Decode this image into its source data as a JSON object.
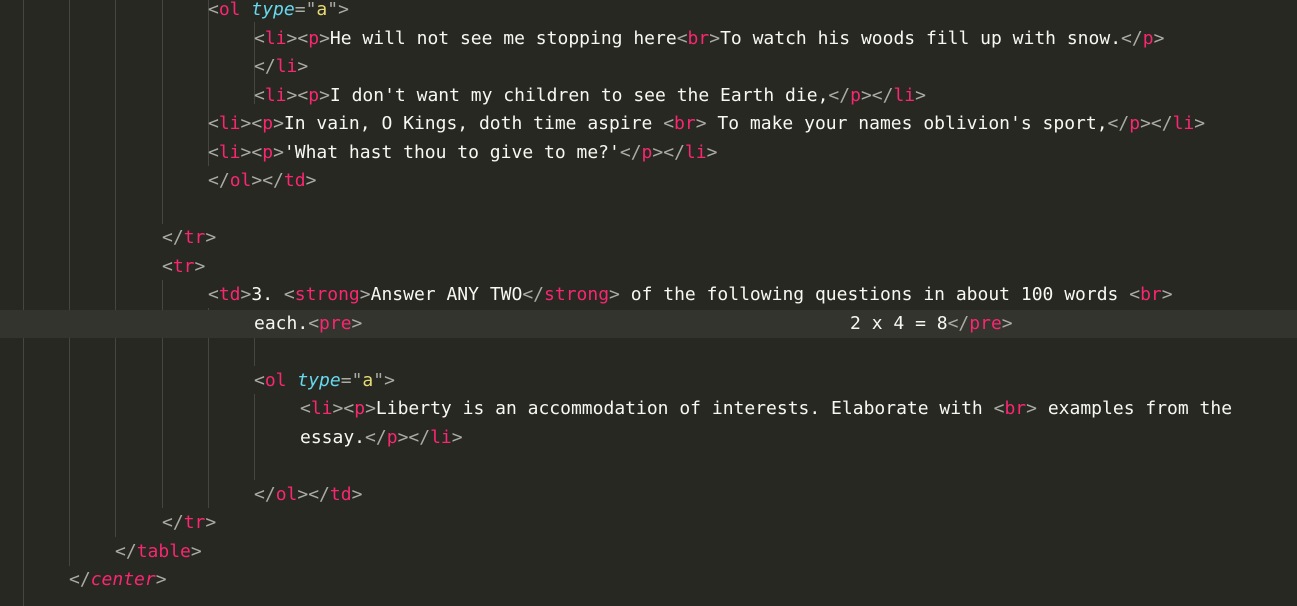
{
  "editor": {
    "colors": {
      "background": "#272822",
      "tag": "#f92672",
      "attribute": "#66d9ef",
      "string": "#e6db74",
      "punctuation": "#a9aba4",
      "text": "#f8f8f2",
      "active_line": "#33342e"
    },
    "active_line_index": 11,
    "lines": [
      [
        [
          "p",
          "<"
        ],
        [
          "t",
          "ol"
        ],
        [
          "x",
          " "
        ],
        [
          "a",
          "type"
        ],
        [
          "p",
          "=\""
        ],
        [
          "q",
          "a"
        ],
        [
          "p",
          "\">"
        ]
      ],
      [
        [
          "p",
          "<"
        ],
        [
          "t",
          "li"
        ],
        [
          "p",
          "><"
        ],
        [
          "t",
          "p"
        ],
        [
          "p",
          ">"
        ],
        [
          "x",
          "He will not see me stopping here"
        ],
        [
          "p",
          "<"
        ],
        [
          "t",
          "br"
        ],
        [
          "p",
          ">"
        ],
        [
          "x",
          "To watch his woods fill up with snow."
        ],
        [
          "p",
          "</"
        ],
        [
          "t",
          "p"
        ],
        [
          "p",
          ">"
        ]
      ],
      [
        [
          "p",
          "</"
        ],
        [
          "t",
          "li"
        ],
        [
          "p",
          ">"
        ]
      ],
      [
        [
          "p",
          "<"
        ],
        [
          "t",
          "li"
        ],
        [
          "p",
          "><"
        ],
        [
          "t",
          "p"
        ],
        [
          "p",
          ">"
        ],
        [
          "x",
          "I don't want my children to see the Earth die,"
        ],
        [
          "p",
          "</"
        ],
        [
          "t",
          "p"
        ],
        [
          "p",
          "></"
        ],
        [
          "t",
          "li"
        ],
        [
          "p",
          ">"
        ]
      ],
      [
        [
          "p",
          "<"
        ],
        [
          "t",
          "li"
        ],
        [
          "p",
          "><"
        ],
        [
          "t",
          "p"
        ],
        [
          "p",
          ">"
        ],
        [
          "x",
          "In vain, O Kings, doth time aspire "
        ],
        [
          "p",
          "<"
        ],
        [
          "t",
          "br"
        ],
        [
          "p",
          ">"
        ],
        [
          "x",
          " To make your names oblivion's sport,"
        ],
        [
          "p",
          "</"
        ],
        [
          "t",
          "p"
        ],
        [
          "p",
          "></"
        ],
        [
          "t",
          "li"
        ],
        [
          "p",
          ">"
        ]
      ],
      [
        [
          "p",
          "<"
        ],
        [
          "t",
          "li"
        ],
        [
          "p",
          "><"
        ],
        [
          "t",
          "p"
        ],
        [
          "p",
          ">"
        ],
        [
          "x",
          "'What hast thou to give to me?'"
        ],
        [
          "p",
          "</"
        ],
        [
          "t",
          "p"
        ],
        [
          "p",
          "></"
        ],
        [
          "t",
          "li"
        ],
        [
          "p",
          ">"
        ]
      ],
      [
        [
          "p",
          "</"
        ],
        [
          "t",
          "ol"
        ],
        [
          "p",
          "></"
        ],
        [
          "t",
          "td"
        ],
        [
          "p",
          ">"
        ]
      ],
      [],
      [
        [
          "p",
          "</"
        ],
        [
          "t",
          "tr"
        ],
        [
          "p",
          ">"
        ]
      ],
      [
        [
          "p",
          "<"
        ],
        [
          "t",
          "tr"
        ],
        [
          "p",
          ">"
        ]
      ],
      [
        [
          "p",
          "<"
        ],
        [
          "t",
          "td"
        ],
        [
          "p",
          ">"
        ],
        [
          "x",
          "3. "
        ],
        [
          "p",
          "<"
        ],
        [
          "t",
          "strong"
        ],
        [
          "p",
          ">"
        ],
        [
          "x",
          "Answer ANY TWO"
        ],
        [
          "p",
          "</"
        ],
        [
          "t",
          "strong"
        ],
        [
          "p",
          ">"
        ],
        [
          "x",
          " of the following questions in about 100 words "
        ],
        [
          "p",
          "<"
        ],
        [
          "t",
          "br"
        ],
        [
          "p",
          ">"
        ]
      ],
      [
        [
          "x",
          "each."
        ],
        [
          "p",
          "<"
        ],
        [
          "t",
          "pre"
        ],
        [
          "p",
          ">"
        ],
        [
          "x",
          "                                             2 x 4 = 8"
        ],
        [
          "p",
          "</"
        ],
        [
          "t",
          "pre"
        ],
        [
          "p",
          ">"
        ]
      ],
      [],
      [
        [
          "p",
          "<"
        ],
        [
          "t",
          "ol"
        ],
        [
          "x",
          " "
        ],
        [
          "a",
          "type"
        ],
        [
          "p",
          "=\""
        ],
        [
          "q",
          "a"
        ],
        [
          "p",
          "\">"
        ]
      ],
      [
        [
          "p",
          "<"
        ],
        [
          "t",
          "li"
        ],
        [
          "p",
          "><"
        ],
        [
          "t",
          "p"
        ],
        [
          "p",
          ">"
        ],
        [
          "x",
          "Liberty is an accommodation of interests. Elaborate with "
        ],
        [
          "p",
          "<"
        ],
        [
          "t",
          "br"
        ],
        [
          "p",
          ">"
        ],
        [
          "x",
          " examples from the"
        ]
      ],
      [
        [
          "x",
          "essay."
        ],
        [
          "p",
          "</"
        ],
        [
          "t",
          "p"
        ],
        [
          "p",
          "></"
        ],
        [
          "t",
          "li"
        ],
        [
          "p",
          ">"
        ]
      ],
      [],
      [
        [
          "p",
          "</"
        ],
        [
          "t",
          "ol"
        ],
        [
          "p",
          "></"
        ],
        [
          "t",
          "td"
        ],
        [
          "p",
          ">"
        ]
      ],
      [
        [
          "p",
          "</"
        ],
        [
          "t",
          "tr"
        ],
        [
          "p",
          ">"
        ]
      ],
      [
        [
          "p",
          "</"
        ],
        [
          "t",
          "table"
        ],
        [
          "p",
          ">"
        ]
      ],
      [
        [
          "p",
          "</"
        ],
        [
          "tagi",
          "center"
        ],
        [
          "p",
          ">"
        ]
      ]
    ]
  }
}
